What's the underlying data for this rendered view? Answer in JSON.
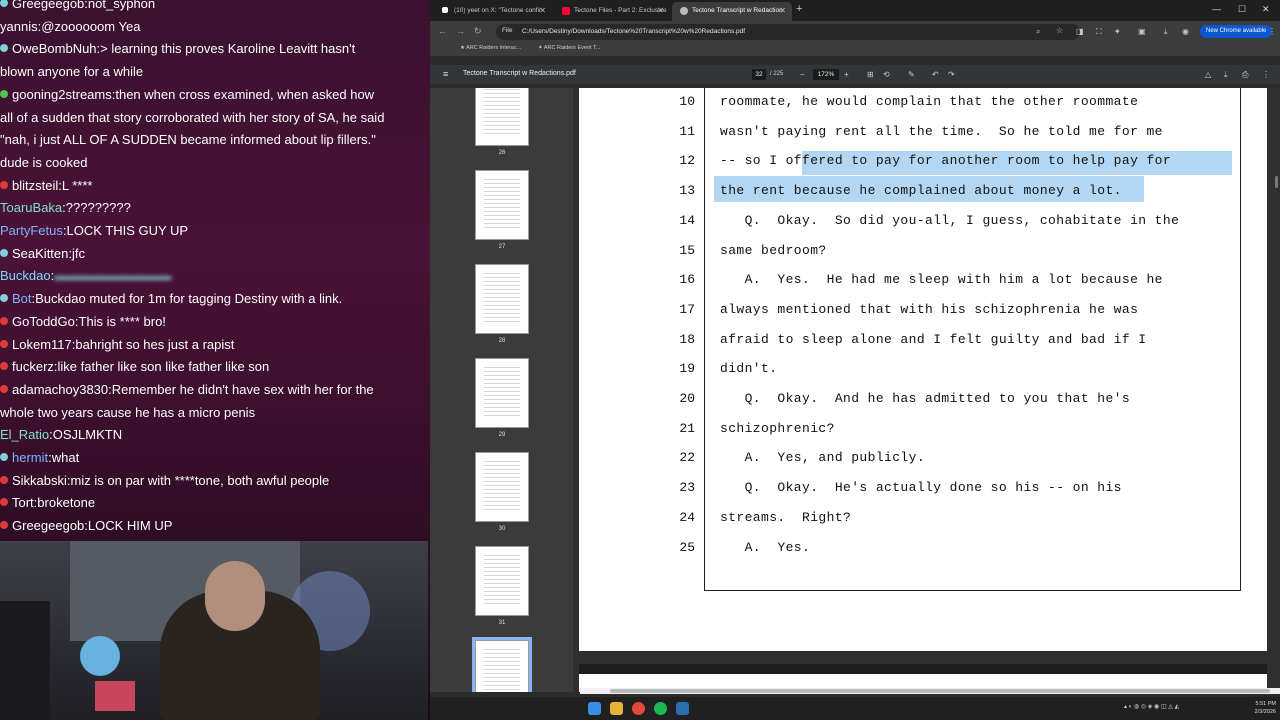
{
  "chat": {
    "messages": [
      {
        "user": "Greegeegob",
        "sep": ":",
        "text": "not_syphon",
        "color": "#ffffff",
        "badge": "#7fd0d8"
      },
      {
        "user": "yannis",
        "sep": ":",
        "text": "@zoooooom Yea",
        "color": "#ffffff",
        "badge": ""
      },
      {
        "user": "OweBombNuh",
        "sep": ":",
        "text": "> learning this proves Karoline Leavitt hasn't",
        "color": "#ffffff",
        "badge": "#7fd0d8"
      },
      {
        "user": "",
        "sep": "",
        "text": "blown anyone for a while",
        "color": "#ffffff",
        "badge": ""
      },
      {
        "user": "gooning2streams",
        "sep": ":",
        "text": "then when cross examined, when asked how",
        "color": "#ffffff",
        "badge": "#4fc24f"
      },
      {
        "user": "",
        "sep": "",
        "text": "all of a sudden that story corroborated with her story of SA, he said",
        "color": "#ffffff",
        "badge": ""
      },
      {
        "user": "",
        "sep": "",
        "text": "\"nah, i just ALL OF A SUDDEN became informed about lip fillers.\"",
        "color": "#ffffff",
        "badge": ""
      },
      {
        "user": "",
        "sep": "",
        "text": "dude is cooked",
        "color": "#ffffff",
        "badge": ""
      },
      {
        "user": "blitzsteil",
        "sep": ":",
        "text": "L ****",
        "color": "#ffffff",
        "badge": "#e03a3a"
      },
      {
        "user": "ToaruBaka",
        "sep": ":",
        "text": "?????????",
        "color": "#7fe3c4",
        "badge": ""
      },
      {
        "user": "PartyFetus",
        "sep": ":",
        "text": "LOCK THIS GUY UP",
        "color": "#7fb3ff",
        "badge": ""
      },
      {
        "user": "SeaKitten",
        "sep": ":",
        "text": "jfc",
        "color": "#ffffff",
        "badge": "#7fd0d8"
      },
      {
        "user": "Buckdao",
        "sep": ":",
        "text": "",
        "color": "#7fd8ff",
        "badge": ""
      },
      {
        "user": "Bot",
        "sep": ":",
        "text": "Buckdao muted for 1m for tagging Destiny with a link.",
        "color": "#7fb3ff",
        "badge": "#7fd0d8"
      },
      {
        "user": "GoToddGo",
        "sep": ":",
        "text": "This is **** bro!",
        "color": "#ffffff",
        "badge": "#e03a3a"
      },
      {
        "user": "Lokem117",
        "sep": ":",
        "text": "bahright so hes just a rapist",
        "color": "#ffffff",
        "badge": "#e03a3a"
      },
      {
        "user": "fuckerz",
        "sep": ":",
        "text": "like father like son  like father like son",
        "color": "#ffffff",
        "badge": "#e03a3a"
      },
      {
        "user": "adamachoy3830",
        "sep": ":",
        "text": "Remember he didn't have sex with her for the",
        "color": "#ffffff",
        "badge": "#e03a3a"
      },
      {
        "user": "",
        "sep": "",
        "text": "whole two years cause he has a micro penis",
        "color": "#ffffff",
        "badge": ""
      },
      {
        "user": "El_Ratio",
        "sep": ":",
        "text": "OSJLMKTN",
        "color": "#7fe3c4",
        "badge": ""
      },
      {
        "user": "hermit",
        "sep": ":",
        "text": "what",
        "color": "#7fb3ff",
        "badge": "#7fd0d8"
      },
      {
        "user": "Sikkabski",
        "sep": ":",
        "text": "miz is on par with ****tone, both awful people",
        "color": "#ffffff",
        "badge": "#e03a3a"
      },
      {
        "user": "Tort",
        "sep": ":",
        "text": "broketone",
        "color": "#ffffff",
        "badge": "#e03a3a"
      },
      {
        "user": "Greegeegob",
        "sep": ":",
        "text": "LOCK HIM UP",
        "color": "#ffffff",
        "badge": "#e03a3a"
      }
    ]
  },
  "browser": {
    "tabs": [
      {
        "label": "(10) yeet on X: \"Tectone confir",
        "icon_color": "#ffffff",
        "active": false
      },
      {
        "label": "Tectone Files - Part 2: Exclusive",
        "icon_color": "#ff3333",
        "active": false
      },
      {
        "label": "Tectone Transcript w Redaction",
        "icon_color": "#bdbdbd",
        "active": true
      }
    ],
    "new_tab": "+",
    "omnibox_chip": "File",
    "url": "C:/Users/Destiny/Downloads/Tectone%20Transcript%20w%20Redactions.pdf",
    "new_chrome_label": "New Chrome available",
    "bookmarks": [
      "ARC Raiders Interac...",
      "ARC Raiders Event T..."
    ]
  },
  "pdf": {
    "title": "Tectone Transcript w Redactions.pdf",
    "current_page": "32",
    "total_pages": "/ 225",
    "zoom": "172%",
    "thumb_pages": [
      "26",
      "27",
      "28",
      "29",
      "30",
      "31",
      "32"
    ],
    "selected_thumb": "32",
    "lines": [
      {
        "num": "10",
        "text": "roommate, he would complain that the other roommate"
      },
      {
        "num": "11",
        "text": "wasn't paying rent all the time.  So he told me for me"
      },
      {
        "num": "12",
        "text": "-- so I offered to pay for another room to help pay for"
      },
      {
        "num": "13",
        "text": "the rent because he complained about money a lot."
      },
      {
        "num": "14",
        "text": "   Q.  Okay.  So did you-all, I guess, cohabitate in the"
      },
      {
        "num": "15",
        "text": "same bedroom?"
      },
      {
        "num": "16",
        "text": "   A.  Yes.  He had me sleep with him a lot because he"
      },
      {
        "num": "17",
        "text": "always mentioned that with his schizophrenia he was"
      },
      {
        "num": "18",
        "text": "afraid to sleep alone and I felt guilty and bad if I"
      },
      {
        "num": "19",
        "text": "didn't."
      },
      {
        "num": "20",
        "text": "   Q.  Okay.  And he has admitted to you that he's"
      },
      {
        "num": "21",
        "text": "schizophrenic?"
      },
      {
        "num": "22",
        "text": "   A.  Yes, and publicly."
      },
      {
        "num": "23",
        "text": "   Q.  Okay.  He's actually done so his -- on his"
      },
      {
        "num": "24",
        "text": "streams.  Right?"
      },
      {
        "num": "25",
        "text": "   A.  Yes."
      }
    ]
  },
  "taskbar": {
    "time": "5:51 PM",
    "date": "2/3/2026"
  }
}
